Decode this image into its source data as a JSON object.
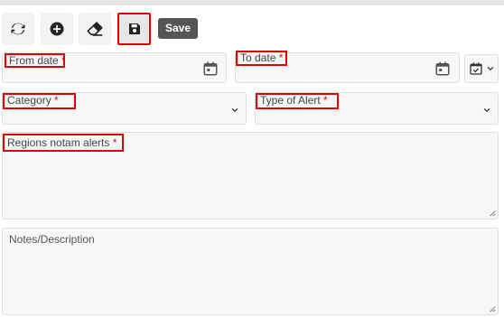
{
  "toolbar": {
    "refresh_icon": "refresh-icon",
    "add_icon": "plus-circle-icon",
    "erase_icon": "eraser-icon",
    "save_icon": "floppy-disk-icon",
    "save_tooltip": "Save"
  },
  "form": {
    "from_date": {
      "label": "From date",
      "required": "*",
      "value": ""
    },
    "to_date": {
      "label": "To date",
      "required": "*",
      "value": ""
    },
    "date_picker_icon": "calendar-check-icon",
    "category": {
      "label": "Category",
      "required": "*",
      "value": ""
    },
    "type_of_alert": {
      "label": "Type of Alert",
      "required": "*",
      "value": ""
    },
    "regions": {
      "label": "Regions notam alerts",
      "required": "*",
      "value": ""
    },
    "notes": {
      "label": "Notes/Description",
      "value": ""
    }
  },
  "colors": {
    "highlight": "#e00000",
    "required": "#d21414",
    "tooltip_bg": "#555555",
    "field_bg": "#f7f7f7"
  }
}
